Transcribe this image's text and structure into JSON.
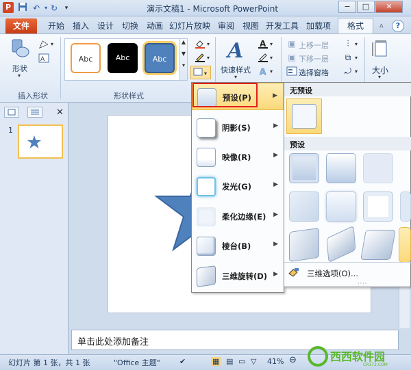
{
  "titlebar": {
    "title": "演示文稿1 - Microsoft PowerPoint",
    "app_icon": "P",
    "min": "−",
    "max": "□",
    "close": "✕"
  },
  "tabs": {
    "file": "文件",
    "items": [
      "开始",
      "插入",
      "设计",
      "切换",
      "动画",
      "幻灯片放映",
      "审阅",
      "视图",
      "开发工具",
      "加载项"
    ],
    "active": "格式"
  },
  "ribbon": {
    "shape_label": "形状",
    "insert_shape_group": "插入形状",
    "shape_styles_group": "形状样式",
    "gallery": [
      "Abc",
      "Abc",
      "Abc"
    ],
    "quick_styles": "快速样式",
    "move_up": "上移一层",
    "move_down": "下移一层",
    "select_pane": "选择窗格",
    "size": "大小"
  },
  "left_panel": {
    "slide_number": "1"
  },
  "menu": {
    "items": [
      {
        "label": "预设(P)"
      },
      {
        "label": "阴影(S)"
      },
      {
        "label": "映像(R)"
      },
      {
        "label": "发光(G)"
      },
      {
        "label": "柔化边缘(E)"
      },
      {
        "label": "棱台(B)"
      },
      {
        "label": "三维旋转(D)"
      }
    ]
  },
  "submenu": {
    "no_preset": "无预设",
    "presets": "预设",
    "options_3d": "三维选项(O)..."
  },
  "notes": {
    "placeholder": "单击此处添加备注"
  },
  "statusbar": {
    "slide_info": "幻灯片 第 1 张，共 1 张",
    "theme": "\"Office 主题\"",
    "zoom": "41%"
  },
  "watermark": {
    "brand": "西西软件园",
    "sub": "CR173.COM"
  },
  "colors": {
    "file_tab": "#d24726",
    "accent_shape": "#4f81bd",
    "highlight": "#fbd97b",
    "red_box": "#e0201b"
  }
}
